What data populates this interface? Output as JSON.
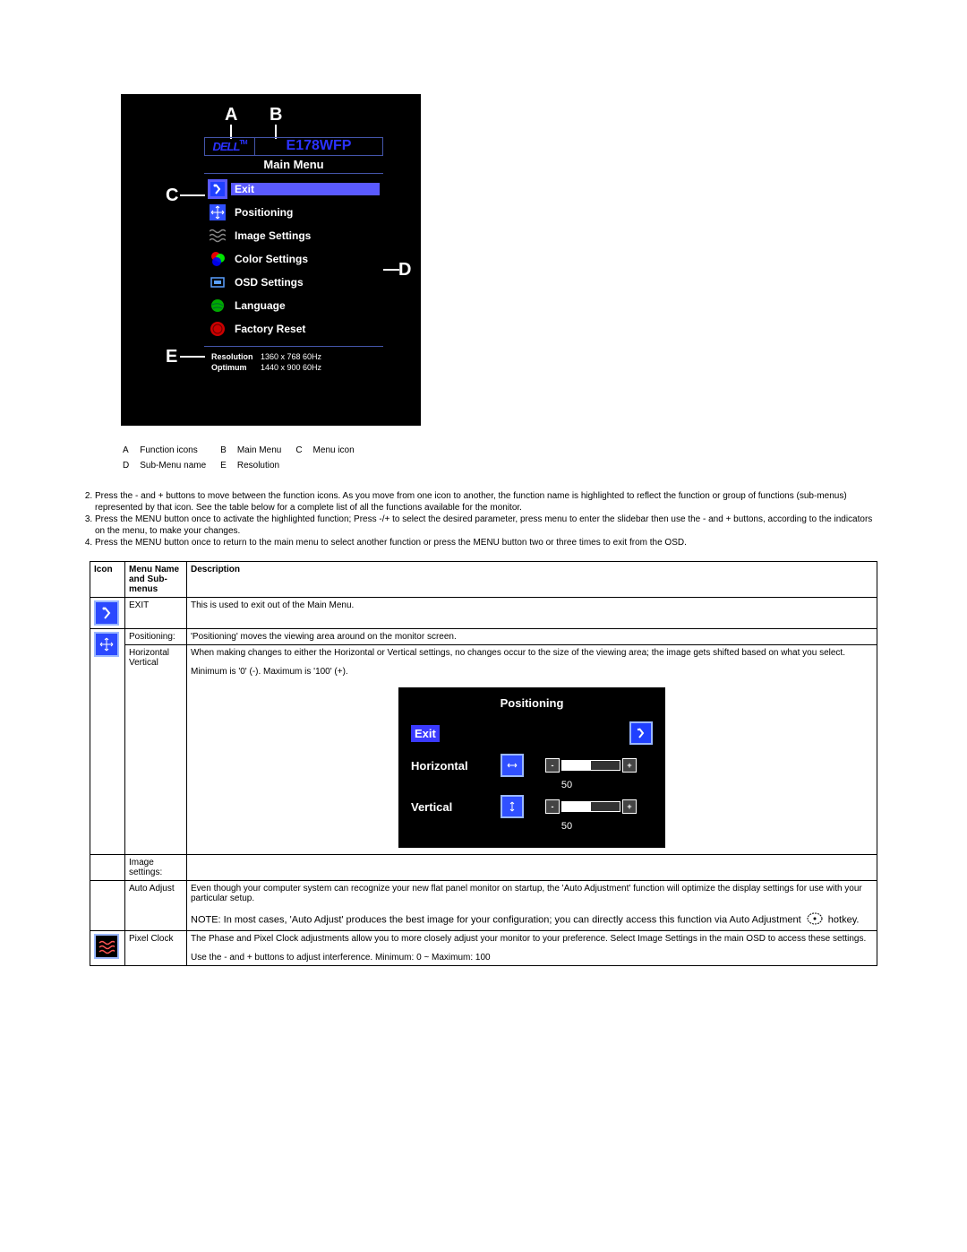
{
  "osd": {
    "brand": "DELL",
    "tm": "TM",
    "model": "E178WFP",
    "main_menu_title": "Main Menu",
    "items": [
      {
        "label": "Exit",
        "icon": "exit-icon"
      },
      {
        "label": "Positioning",
        "icon": "positioning-icon"
      },
      {
        "label": "Image Settings",
        "icon": "image-settings-icon"
      },
      {
        "label": "Color Settings",
        "icon": "color-settings-icon"
      },
      {
        "label": "OSD Settings",
        "icon": "osd-settings-icon"
      },
      {
        "label": "Language",
        "icon": "language-icon"
      },
      {
        "label": "Factory Reset",
        "icon": "factory-reset-icon"
      }
    ],
    "resolution_label": "Resolution",
    "resolution_value": "1360 x 768  60Hz",
    "optimum_label": "Optimum",
    "optimum_value": "1440 x 900  60Hz",
    "callouts": {
      "A": "A",
      "B": "B",
      "C": "C",
      "D": "D",
      "E": "E"
    }
  },
  "legend": {
    "A": "Function icons",
    "B": "Main Menu",
    "C": "Menu icon",
    "D": "Sub-Menu name",
    "E": "Resolution"
  },
  "steps": [
    "Press the - and + buttons to move between the function icons. As you move from one icon to another, the function name is highlighted to reflect the function or group of functions (sub-menus) represented by that icon. See the table below for a complete list of all the functions available for the monitor.",
    "Press the MENU button once to activate the highlighted function; Press -/+ to select the desired parameter, press menu to enter the slidebar then use the - and + buttons, according to the indicators on the menu, to make your changes.",
    "Press the MENU button once to return to the main menu to select another function or press the MENU button two or three times to exit from the OSD."
  ],
  "table": {
    "headers": {
      "icon": "Icon",
      "name": "Menu Name and Sub-menus",
      "desc": "Description"
    },
    "rows": {
      "exit": {
        "name": "EXIT",
        "desc": "This is used to exit out of the Main Menu."
      },
      "positioning": {
        "name": "Positioning:",
        "desc_main": "'Positioning' moves the viewing area around on the monitor screen.",
        "hv_label": "Horizontal Vertical",
        "hv_desc1": "When making changes to either the Horizontal or Vertical settings, no changes occur to the size of the viewing area; the image gets shifted based on what you select.",
        "hv_desc2": "Minimum is '0' (-). Maximum is '100' (+).",
        "panel": {
          "title": "Positioning",
          "exit": "Exit",
          "horizontal": "Horizontal",
          "vertical": "Vertical",
          "hval": "50",
          "vval": "50"
        }
      },
      "image": {
        "name": "Image settings:",
        "auto_label": "Auto Adjust",
        "auto_desc": "Even though your computer system can recognize your new flat panel monitor on startup, the 'Auto Adjustment' function will optimize the display settings for use with your particular setup.",
        "note": "NOTE: In most cases, 'Auto Adjust' produces the best image for your configuration; you can directly access this function via Auto Adjustment",
        "note_suffix": "hotkey.",
        "pixel_label": "Pixel Clock",
        "pixel_desc1": "The Phase and Pixel Clock adjustments allow you to more closely adjust your monitor to your preference. Select Image Settings in the main OSD to access these settings.",
        "pixel_desc2": "Use the - and + buttons to adjust interference. Minimum: 0 ~ Maximum: 100"
      }
    }
  }
}
